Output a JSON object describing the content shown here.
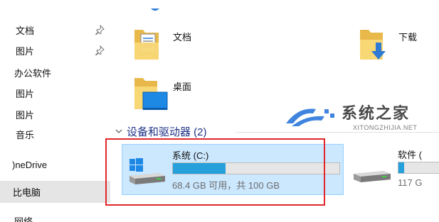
{
  "sidebar": {
    "items": [
      {
        "label": "文档",
        "pinned": true
      },
      {
        "label": "图片",
        "pinned": true
      },
      {
        "label": "办公软件",
        "pinned": false
      },
      {
        "label": "图片",
        "pinned": false
      },
      {
        "label": "图片",
        "pinned": false
      },
      {
        "label": "音乐",
        "pinned": false
      },
      {
        "label": ")neDrive",
        "pinned": false
      },
      {
        "label": "比电脑",
        "pinned": false,
        "selected": true
      },
      {
        "label": "网络",
        "pinned": false
      }
    ]
  },
  "folders": [
    {
      "label": "文档",
      "icon": "documents-folder-icon"
    },
    {
      "label": "下载",
      "icon": "downloads-folder-icon"
    },
    {
      "label": "桌面",
      "icon": "desktop-folder-icon"
    }
  ],
  "devices_section": {
    "title": "设备和驱动器 (2)"
  },
  "drives": [
    {
      "name": "系统 (C:)",
      "free_text": "68.4 GB 可用，共 100 GB",
      "used_fraction": 0.316,
      "icon": "windows-drive-icon",
      "selected": true
    },
    {
      "name": "软件 (",
      "free_text": "117 G",
      "used_fraction": 0.1,
      "icon": "hard-drive-icon",
      "selected": false
    }
  ],
  "watermark": {
    "brand": "系统之家",
    "url": "XITONGZHIJIA.NET"
  },
  "colors": {
    "selection_bg": "#cce8ff",
    "selection_border": "#99d1ff",
    "usage_bar": "#26a0da",
    "section_header": "#1e3287",
    "annotation_red": "#e0262b",
    "folder_yellow": "#f8d775",
    "download_blue": "#2e7bd6"
  }
}
